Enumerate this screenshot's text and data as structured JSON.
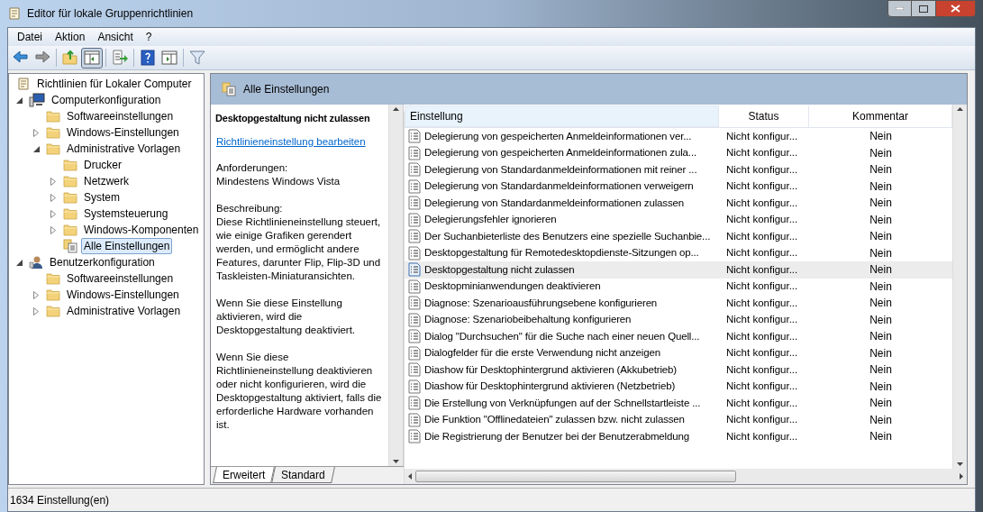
{
  "window": {
    "title": "Editor für lokale Gruppenrichtlinien"
  },
  "menu": [
    "Datei",
    "Aktion",
    "Ansicht",
    "?"
  ],
  "toolbar": [
    {
      "kind": "back",
      "pressed": false
    },
    {
      "kind": "forward",
      "pressed": false
    },
    {
      "kind": "sep"
    },
    {
      "kind": "up",
      "pressed": false
    },
    {
      "kind": "tree",
      "pressed": true
    },
    {
      "kind": "sep"
    },
    {
      "kind": "export",
      "pressed": false
    },
    {
      "kind": "sep"
    },
    {
      "kind": "help",
      "pressed": false
    },
    {
      "kind": "pane",
      "pressed": false
    },
    {
      "kind": "sep"
    },
    {
      "kind": "filter",
      "pressed": false
    }
  ],
  "tree": [
    {
      "label": "Richtlinien für Lokaler Computer",
      "kind": "policy",
      "selected": false,
      "children": [
        {
          "label": "Computerkonfiguration",
          "kind": "computer",
          "expanded": true,
          "selected": false,
          "children": [
            {
              "label": "Softwareeinstellungen",
              "kind": "folder",
              "selected": false
            },
            {
              "label": "Windows-Einstellungen",
              "kind": "folder",
              "expanded": false,
              "selected": false
            },
            {
              "label": "Administrative Vorlagen",
              "kind": "folder",
              "expanded": true,
              "selected": false,
              "children": [
                {
                  "label": "Drucker",
                  "kind": "folder",
                  "selected": false
                },
                {
                  "label": "Netzwerk",
                  "kind": "folder",
                  "expanded": false,
                  "selected": false
                },
                {
                  "label": "System",
                  "kind": "folder",
                  "expanded": false,
                  "selected": false
                },
                {
                  "label": "Systemsteuerung",
                  "kind": "folder",
                  "expanded": false,
                  "selected": false
                },
                {
                  "label": "Windows-Komponenten",
                  "kind": "folder",
                  "expanded": false,
                  "selected": false
                },
                {
                  "label": "Alle Einstellungen",
                  "kind": "settings",
                  "selected": true
                }
              ]
            }
          ]
        },
        {
          "label": "Benutzerkonfiguration",
          "kind": "user",
          "expanded": true,
          "selected": false,
          "children": [
            {
              "label": "Softwareeinstellungen",
              "kind": "folder",
              "selected": false
            },
            {
              "label": "Windows-Einstellungen",
              "kind": "folder",
              "expanded": false,
              "selected": false
            },
            {
              "label": "Administrative Vorlagen",
              "kind": "folder",
              "expanded": false,
              "selected": false
            }
          ]
        }
      ]
    }
  ],
  "pane_header": "Alle Einstellungen",
  "description": {
    "title": "Desktopgestaltung nicht zulassen",
    "link": "Richtlinieneinstellung bearbeiten",
    "paragraphs": [
      "Anforderungen:\nMindestens Windows Vista",
      "Beschreibung:\nDiese Richtlinieneinstellung steuert, wie einige Grafiken gerendert werden, und ermöglicht andere Features, darunter Flip, Flip-3D und Taskleisten-Miniaturansichten.",
      "Wenn Sie diese Einstellung aktivieren, wird die Desktopgestaltung deaktiviert.",
      "Wenn Sie diese Richtlinieneinstellung deaktivieren oder nicht konfigurieren, wird die Desktopgestaltung aktiviert, falls die erforderliche Hardware vorhanden ist."
    ]
  },
  "view_tabs": [
    {
      "label": "Erweitert",
      "selected": true
    },
    {
      "label": "Standard",
      "selected": false
    }
  ],
  "table": {
    "columns": [
      "Einstellung",
      "Status",
      "Kommentar"
    ],
    "rows": [
      {
        "setting": "Delegierung von gespeicherten Anmeldeinformationen ver...",
        "status": "Nicht konfigur...",
        "comment": "Nein",
        "selected": false
      },
      {
        "setting": "Delegierung von gespeicherten Anmeldeinformationen zula...",
        "status": "Nicht konfigur...",
        "comment": "Nein",
        "selected": false
      },
      {
        "setting": "Delegierung von Standardanmeldeinformationen mit reiner ...",
        "status": "Nicht konfigur...",
        "comment": "Nein",
        "selected": false
      },
      {
        "setting": "Delegierung von Standardanmeldeinformationen verweigern",
        "status": "Nicht konfigur...",
        "comment": "Nein",
        "selected": false
      },
      {
        "setting": "Delegierung von Standardanmeldeinformationen zulassen",
        "status": "Nicht konfigur...",
        "comment": "Nein",
        "selected": false
      },
      {
        "setting": "Delegierungsfehler ignorieren",
        "status": "Nicht konfigur...",
        "comment": "Nein",
        "selected": false
      },
      {
        "setting": "Der Suchanbieterliste des Benutzers eine spezielle Suchanbie...",
        "status": "Nicht konfigur...",
        "comment": "Nein",
        "selected": false
      },
      {
        "setting": "Desktopgestaltung für Remotedesktopdienste-Sitzungen op...",
        "status": "Nicht konfigur...",
        "comment": "Nein",
        "selected": false
      },
      {
        "setting": "Desktopgestaltung nicht zulassen",
        "status": "Nicht konfigur...",
        "comment": "Nein",
        "selected": true
      },
      {
        "setting": "Desktopminianwendungen deaktivieren",
        "status": "Nicht konfigur...",
        "comment": "Nein",
        "selected": false
      },
      {
        "setting": "Diagnose: Szenarioausführungsebene konfigurieren",
        "status": "Nicht konfigur...",
        "comment": "Nein",
        "selected": false
      },
      {
        "setting": "Diagnose: Szenariobeibehaltung konfigurieren",
        "status": "Nicht konfigur...",
        "comment": "Nein",
        "selected": false
      },
      {
        "setting": "Dialog \"Durchsuchen\" für die Suche nach einer neuen Quell...",
        "status": "Nicht konfigur...",
        "comment": "Nein",
        "selected": false
      },
      {
        "setting": "Dialogfelder für die erste Verwendung nicht anzeigen",
        "status": "Nicht konfigur...",
        "comment": "Nein",
        "selected": false
      },
      {
        "setting": "Diashow für Desktophintergrund aktivieren (Akkubetrieb)",
        "status": "Nicht konfigur...",
        "comment": "Nein",
        "selected": false
      },
      {
        "setting": "Diashow für Desktophintergrund aktivieren (Netzbetrieb)",
        "status": "Nicht konfigur...",
        "comment": "Nein",
        "selected": false
      },
      {
        "setting": "Die Erstellung von Verknüpfungen auf der Schnellstartleiste ...",
        "status": "Nicht konfigur...",
        "comment": "Nein",
        "selected": false
      },
      {
        "setting": "Die Funktion \"Offlinedateien\" zulassen bzw. nicht zulassen",
        "status": "Nicht konfigur...",
        "comment": "Nein",
        "selected": false
      },
      {
        "setting": "Die Registrierung der Benutzer bei der Benutzerabmeldung",
        "status": "Nicht konfigur...",
        "comment": "Nein",
        "selected": false
      }
    ]
  },
  "status_bar": "1634 Einstellung(en)"
}
